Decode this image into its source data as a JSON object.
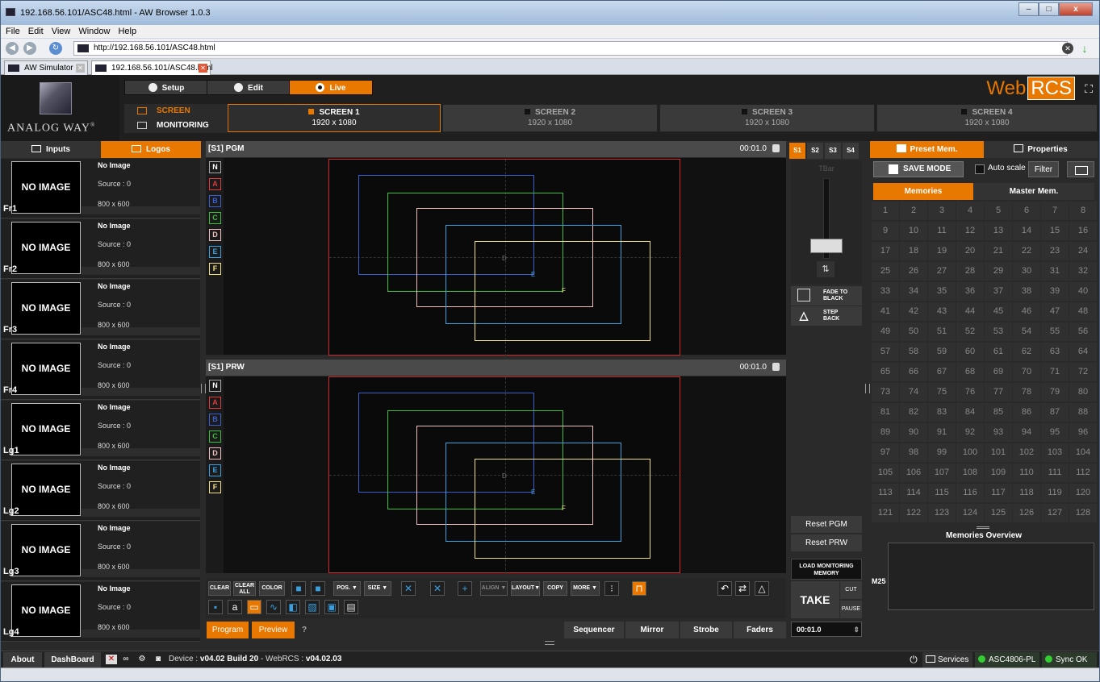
{
  "browser": {
    "title": "192.168.56.101/ASC48.html - AW Browser 1.0.3",
    "menu": [
      "File",
      "Edit",
      "View",
      "Window",
      "Help"
    ],
    "url": "http://192.168.56.101/ASC48.html",
    "tabs": [
      {
        "label": "AW Simulator",
        "active": false
      },
      {
        "label": "192.168.56.101/ASC48.html",
        "active": true
      }
    ],
    "window_buttons": [
      "–",
      "□",
      "x"
    ]
  },
  "header": {
    "brand": "ANALOG WAY",
    "brand_mark": "®",
    "modes": [
      "Setup",
      "Edit",
      "Live"
    ],
    "active_mode": "Live",
    "webrcs_web": "Web",
    "webrcs_rcs": "RCS",
    "screen_modes": [
      "SCREEN",
      "MONITORING"
    ],
    "screens": [
      {
        "name": "SCREEN 1",
        "res": "1920 x 1080",
        "selected": true
      },
      {
        "name": "SCREEN 2",
        "res": "1920 x 1080",
        "selected": false
      },
      {
        "name": "SCREEN 3",
        "res": "1920 x 1080",
        "selected": false
      },
      {
        "name": "SCREEN 4",
        "res": "1920 x 1080",
        "selected": false
      }
    ]
  },
  "left_panel": {
    "tabs": [
      "Inputs",
      "Logos"
    ],
    "active_tab": "Logos",
    "items": [
      {
        "thumb": "NO IMAGE",
        "id": "Fr1",
        "title": "No Image",
        "source": "Source : 0",
        "size": "800 x 600"
      },
      {
        "thumb": "NO IMAGE",
        "id": "Fr2",
        "title": "No Image",
        "source": "Source : 0",
        "size": "800 x 600"
      },
      {
        "thumb": "NO IMAGE",
        "id": "Fr3",
        "title": "No Image",
        "source": "Source : 0",
        "size": "800 x 600"
      },
      {
        "thumb": "NO IMAGE",
        "id": "Fr4",
        "title": "No Image",
        "source": "Source : 0",
        "size": "800 x 600"
      },
      {
        "thumb": "NO IMAGE",
        "id": "Lg1",
        "title": "No Image",
        "source": "Source : 0",
        "size": "800 x 600"
      },
      {
        "thumb": "NO IMAGE",
        "id": "Lg2",
        "title": "No Image",
        "source": "Source : 0",
        "size": "800 x 600"
      },
      {
        "thumb": "NO IMAGE",
        "id": "Lg3",
        "title": "No Image",
        "source": "Source : 0",
        "size": "800 x 600"
      },
      {
        "thumb": "NO IMAGE",
        "id": "Lg4",
        "title": "No Image",
        "source": "Source : 0",
        "size": "800 x 600"
      }
    ]
  },
  "pgm": {
    "title": "[S1] PGM",
    "time": "00:01.0"
  },
  "prw": {
    "title": "[S1] PRW",
    "time": "00:01.0"
  },
  "layers": [
    {
      "label": "N",
      "color": "#ffffff"
    },
    {
      "label": "A",
      "color": "#e03a3a"
    },
    {
      "label": "B",
      "color": "#3a5fd0"
    },
    {
      "label": "C",
      "color": "#3cc03c"
    },
    {
      "label": "D",
      "color": "#f0c0c0"
    },
    {
      "label": "E",
      "color": "#3aa0e0"
    },
    {
      "label": "F",
      "color": "#f0e080"
    }
  ],
  "canvas_labels": {
    "d": "D",
    "e": "E",
    "f": "F"
  },
  "toolbar": {
    "clear": "CLEAR",
    "clear_all_1": "CLEAR",
    "clear_all_2": "ALL",
    "color": "COLOR",
    "pos": "POS. ▼",
    "size": "SIZE ▼",
    "align": "ALIGN ▼",
    "layout": "LAYOUT▼",
    "copy": "COPY",
    "more": "MORE ▼",
    "help": "?"
  },
  "bottom_tabs": {
    "program": "Program",
    "preview": "Preview",
    "sequencer": "Sequencer",
    "mirror": "Mirror",
    "strobe": "Strobe",
    "faders": "Faders"
  },
  "transition": {
    "screen_tabs": [
      "S1",
      "S2",
      "S3",
      "S4"
    ],
    "active_screen": "S1",
    "tbar_label": "TBar",
    "fade_1": "FADE TO",
    "fade_2": "BLACK",
    "step_1": "STEP",
    "step_2": "BACK",
    "reset_pgm": "Reset PGM",
    "reset_prw": "Reset PRW",
    "load_1": "LOAD MONITORING",
    "load_2": "MEMORY",
    "take": "TAKE",
    "cut": "CUT",
    "pause": "PAUSE",
    "duration": "00:01.0"
  },
  "right_panel": {
    "tabs": [
      "Preset Mem.",
      "Properties"
    ],
    "active_tab": "Preset Mem.",
    "save_mode": "SAVE MODE",
    "auto_scale": "Auto scale",
    "filter": "Filter",
    "mem_tabs": [
      "Memories",
      "Master Mem."
    ],
    "active_mem_tab": "Memories",
    "memory_count": 128,
    "overview_title": "Memories Overview",
    "overview_label": "M25"
  },
  "footer": {
    "about": "About",
    "dashboard": "DashBoard",
    "device_label": "Device : ",
    "device_ver": "v04.02 Build 20",
    "sep": " - WebRCS : ",
    "webrcs_ver": "v04.02.03",
    "services": "Services",
    "asc": "ASC4806-PL",
    "sync": "Sync OK"
  }
}
